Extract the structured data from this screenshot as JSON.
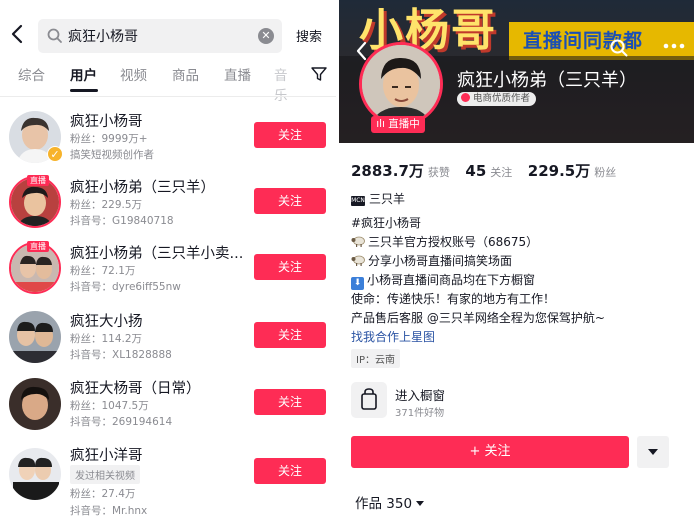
{
  "search": {
    "query": "疯狂小杨哥",
    "button_label": "搜索"
  },
  "tabs": [
    {
      "label": "综合",
      "active": false
    },
    {
      "label": "用户",
      "active": true
    },
    {
      "label": "视频",
      "active": false
    },
    {
      "label": "商品",
      "active": false
    },
    {
      "label": "直播",
      "active": false
    },
    {
      "label": "音乐",
      "active": false
    }
  ],
  "users": [
    {
      "name": "疯狂小杨哥",
      "line1": "粉丝：9999万+",
      "line2": "搞笑短视频创作者",
      "follow": "关注",
      "live": false,
      "verified": true
    },
    {
      "name": "疯狂小杨弟（三只羊）",
      "line1": "粉丝：229.5万",
      "line2": "抖音号：G19840718",
      "follow": "关注",
      "live": true,
      "live_tag": "直播"
    },
    {
      "name": "疯狂小杨弟（三只羊小卖...",
      "line1": "粉丝：72.1万",
      "line2": "抖音号：dyre6iff55nw",
      "follow": "关注",
      "live": true,
      "live_tag": "直播"
    },
    {
      "name": "疯狂大小扬",
      "line1": "粉丝：114.2万",
      "line2": "抖音号：XL1828888",
      "follow": "关注",
      "live": false
    },
    {
      "name": "疯狂大杨哥（日常）",
      "line1": "粉丝：1047.5万",
      "line2": "抖音号：269194614",
      "follow": "关注",
      "live": false
    },
    {
      "name": "疯狂小洋哥",
      "tag": "发过相关视频",
      "line1": "粉丝：27.4万",
      "line2": "抖音号：Mr.hnx",
      "follow": "关注",
      "live": false
    }
  ],
  "profile": {
    "banner_title": "小杨哥",
    "banner_subtitle": "直播间同款都",
    "name": "疯狂小杨弟（三只羊）",
    "badge": "电商优质作者",
    "live_label": "直播中",
    "likes_value": "2883.7万",
    "likes_label": "获赞",
    "following_value": "45",
    "following_label": "关注",
    "fans_value": "229.5万",
    "fans_label": "粉丝",
    "mcn_label": "MCN",
    "team": "三只羊",
    "bio": [
      "#疯狂小杨哥",
      "三只羊官方授权账号（68675）",
      "分享小杨哥直播间搞笑场面",
      "小杨哥直播间商品均在下方橱窗",
      "使命：传递快乐！有家的地方有工作！",
      "产品售后客服 @三只羊网络全程为您保驾护航~"
    ],
    "cooperation_link": "找我合作上星图",
    "ip": "IP：云南",
    "shop_title": "进入橱窗",
    "shop_sub": "371件好物",
    "follow_button": "+ 关注",
    "works_label": "作品 350"
  },
  "colors": {
    "accent": "#fe2c55",
    "text": "#161823",
    "secondary": "#8a8b91",
    "link": "#2a53a3"
  }
}
